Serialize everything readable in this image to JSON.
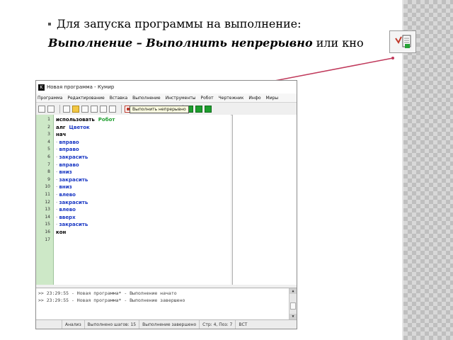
{
  "slide": {
    "line1": "Для запуска программы на выполнение:",
    "line2_emphasis": "Выполнение – Выполнить непрерывно",
    "line2_rest": " или кно"
  },
  "window": {
    "title": "Новая программа - Кумир",
    "menu": [
      "Программа",
      "Редактирование",
      "Вставка",
      "Выполнение",
      "Инструменты",
      "Робот",
      "Чертежник",
      "Инфо",
      "Миры"
    ],
    "tooltip": "Выполнить непрерывно"
  },
  "code_lines": [
    {
      "num": "1",
      "text": "использовать",
      "extra": "Робот"
    },
    {
      "num": "2",
      "text": "алг",
      "extra": "Цветок"
    },
    {
      "num": "3",
      "text": "нач",
      "extra": ""
    },
    {
      "num": "4",
      "text": "вправо"
    },
    {
      "num": "5",
      "text": "вправо"
    },
    {
      "num": "6",
      "text": "закрасить"
    },
    {
      "num": "7",
      "text": "вправо"
    },
    {
      "num": "8",
      "text": "вниз"
    },
    {
      "num": "9",
      "text": "закрасить"
    },
    {
      "num": "10",
      "text": "вниз"
    },
    {
      "num": "11",
      "text": "влево"
    },
    {
      "num": "12",
      "text": "закрасить"
    },
    {
      "num": "13",
      "text": "влево"
    },
    {
      "num": "14",
      "text": "вверх"
    },
    {
      "num": "15",
      "text": "закрасить"
    },
    {
      "num": "16",
      "text": "кон"
    },
    {
      "num": "17",
      "text": ""
    }
  ],
  "console": [
    ">> 23:29:55 - Новая программа* - Выполнение начато",
    ">> 23:29:55 - Новая программа* - Выполнение завершено"
  ],
  "status": {
    "mode": "Анализ",
    "steps": "Выполнено шагов: 15",
    "state": "Выполнение завершено",
    "position": "Стр: 4, Поз: 7",
    "ins": "ВСТ"
  },
  "colors": {
    "gutter": "#cde8c7",
    "command_blue": "#1a38c4",
    "robot_green": "#1e9e2e",
    "pointer_line": "#c0395b"
  }
}
